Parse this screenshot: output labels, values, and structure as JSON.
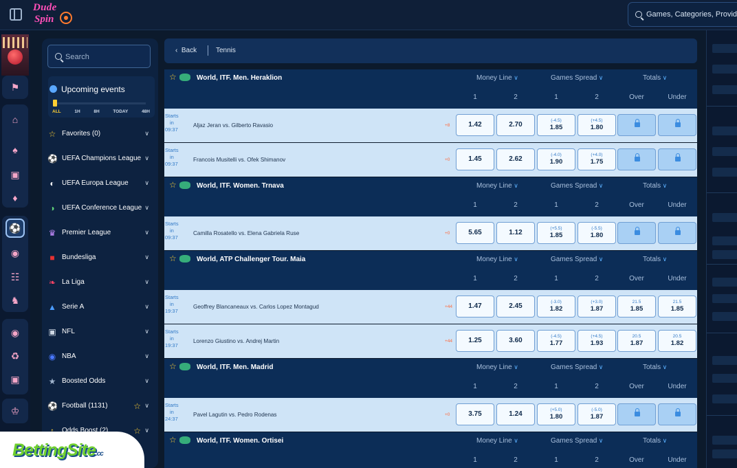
{
  "brand": {
    "line1": "Dude",
    "line2": "Spin"
  },
  "top_search": {
    "placeholder": "Games, Categories, Providers"
  },
  "sidebar": {
    "search_placeholder": "Search",
    "upcoming_title": "Upcoming events",
    "time_filters": [
      "ALL",
      "1H",
      "8H",
      "TODAY",
      "48H"
    ],
    "items": [
      {
        "label": "Favorites (0)",
        "icon": "star-icon"
      },
      {
        "label": "UEFA Champions League",
        "icon": "soccer-ball-icon"
      },
      {
        "label": "UEFA Europa League",
        "icon": "europa-league-icon"
      },
      {
        "label": "UEFA Conference League",
        "icon": "conference-league-icon"
      },
      {
        "label": "Premier League",
        "icon": "premier-league-icon"
      },
      {
        "label": "Bundesliga",
        "icon": "bundesliga-icon"
      },
      {
        "label": "La Liga",
        "icon": "la-liga-icon"
      },
      {
        "label": "Serie A",
        "icon": "serie-a-icon"
      },
      {
        "label": "NFL",
        "icon": "nfl-icon"
      },
      {
        "label": "NBA",
        "icon": "nba-icon"
      },
      {
        "label": "Boosted Odds",
        "icon": "boosted-odds-icon"
      },
      {
        "label": "Football (1131)",
        "icon": "soccer-ball-icon"
      },
      {
        "label": "Odds Boost (2)",
        "icon": "odds-boost-icon"
      }
    ]
  },
  "breadcrumb": {
    "back": "Back",
    "current": "Tennis"
  },
  "market_headers": {
    "money_line": "Money Line",
    "games_spread": "Games Spread",
    "totals": "Totals",
    "col1": "1",
    "col2": "2",
    "over": "Over",
    "under": "Under"
  },
  "leagues": [
    {
      "name": "World, ITF. Men. Heraklion",
      "matches": [
        {
          "starts": "Starts",
          "in": "in",
          "time": "09:37",
          "teams": "Aljaz Jeran  vs.  Gilberto Ravasio",
          "more": "+8",
          "ml": [
            "1.42",
            "2.70"
          ],
          "spread": [
            {
              "h": "(-4.5)",
              "v": "1.85"
            },
            {
              "h": "(+4.5)",
              "v": "1.80"
            }
          ],
          "totals": null
        },
        {
          "starts": "Starts",
          "in": "in",
          "time": "09:37",
          "teams": "Francois Musitelli  vs.  Ofek Shimanov",
          "more": "+0",
          "ml": [
            "1.45",
            "2.62"
          ],
          "spread": [
            {
              "h": "(-4.0)",
              "v": "1.90"
            },
            {
              "h": "(+4.0)",
              "v": "1.75"
            }
          ],
          "totals": null
        }
      ]
    },
    {
      "name": "World, ITF. Women. Trnava",
      "matches": [
        {
          "starts": "Starts",
          "in": "in",
          "time": "09:37",
          "teams": "Camilla Rosatello  vs.  Elena Gabriela Ruse",
          "more": "+0",
          "ml": [
            "5.65",
            "1.12"
          ],
          "spread": [
            {
              "h": "(+5.5)",
              "v": "1.85"
            },
            {
              "h": "(-5.5)",
              "v": "1.80"
            }
          ],
          "totals": null
        }
      ]
    },
    {
      "name": "World, ATP Challenger Tour. Maia",
      "matches": [
        {
          "starts": "Starts",
          "in": "in",
          "time": "19:37",
          "teams": "Geoffrey Blancaneaux  vs.  Carlos Lopez Montagud",
          "more": "+44",
          "ml": [
            "1.47",
            "2.45"
          ],
          "spread": [
            {
              "h": "(-3.0)",
              "v": "1.82"
            },
            {
              "h": "(+3.0)",
              "v": "1.87"
            }
          ],
          "totals": [
            {
              "h": "21.5",
              "v": "1.85"
            },
            {
              "h": "21.5",
              "v": "1.85"
            }
          ]
        },
        {
          "starts": "Starts",
          "in": "in",
          "time": "19:37",
          "teams": "Lorenzo Giustino  vs.  Andrej Martin",
          "more": "+44",
          "ml": [
            "1.25",
            "3.60"
          ],
          "spread": [
            {
              "h": "(-4.5)",
              "v": "1.77"
            },
            {
              "h": "(+4.5)",
              "v": "1.93"
            }
          ],
          "totals": [
            {
              "h": "20.5",
              "v": "1.87"
            },
            {
              "h": "20.5",
              "v": "1.82"
            }
          ]
        }
      ]
    },
    {
      "name": "World, ITF. Men. Madrid",
      "matches": [
        {
          "starts": "Starts",
          "in": "in",
          "time": "24:37",
          "teams": "Pavel Lagutin  vs.  Pedro Rodenas",
          "more": "+0",
          "ml": [
            "3.75",
            "1.24"
          ],
          "spread": [
            {
              "h": "(+5.0)",
              "v": "1.80"
            },
            {
              "h": "(-5.0)",
              "v": "1.87"
            }
          ],
          "totals": null
        }
      ]
    },
    {
      "name": "World, ITF. Women. Ortisei",
      "matches": []
    }
  ],
  "watermark": {
    "text": "BettingSite",
    "suffix": ".cc"
  },
  "colors": {
    "accent": "#5bb0ff",
    "odds_border": "#6f9ed3",
    "match_bg": "#cfe4f7",
    "league_bg": "#0c2d57"
  }
}
